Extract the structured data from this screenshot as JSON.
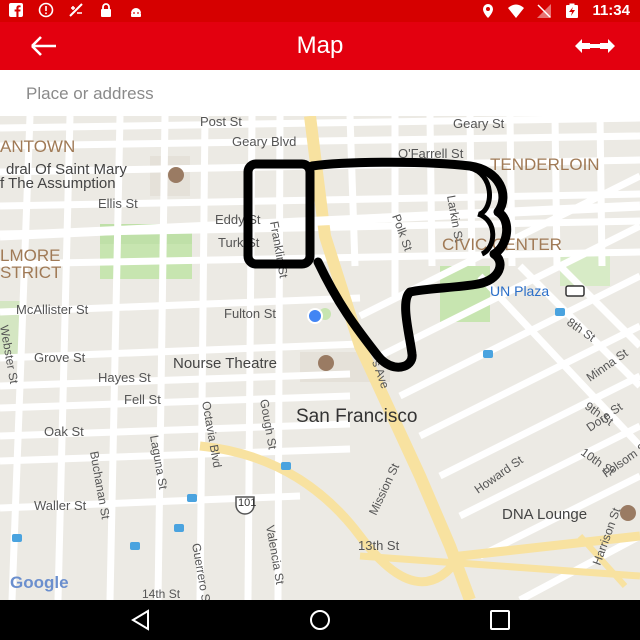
{
  "status_bar": {
    "time": "11:34",
    "icons": [
      "facebook-icon",
      "alert-icon",
      "no-signal-icon",
      "lock-icon",
      "android-icon",
      "location-icon",
      "wifi-icon",
      "no-sim-icon",
      "battery-charging-icon"
    ]
  },
  "app_bar": {
    "title": "Map",
    "back_icon": "arrow-left-icon",
    "action_icon": "swap-arrows-icon",
    "background": "#e3000f"
  },
  "search": {
    "placeholder": "Place or address"
  },
  "map": {
    "labels": {
      "post_st": "Post St",
      "geary_blvd": "Geary Blvd",
      "geary_st": "Geary St",
      "ofarrell_st": "O'Farrell St",
      "antown": "ANTOWN",
      "cathedral_1": "dral Of Saint Mary",
      "cathedral_2": "f The Assumption",
      "tenderloin": "TENDERLOIN",
      "ellis_st": "Ellis St",
      "eddy_st": "Eddy St",
      "turk_st": "Turk St",
      "franklin_st": "Franklin St",
      "polk_st": "Polk St",
      "larkin_st": "Larkin St",
      "civic_center": "CIVIC CENTER",
      "fillmore_1": "LMORE",
      "fillmore_2": "STRICT",
      "un_plaza": "UN Plaza",
      "mcallister_st": "McAllister St",
      "fulton_st": "Fulton St",
      "webster_st": "Webster St",
      "grove_st": "Grove St",
      "eighth_st": "8th St",
      "nourse_theatre": "Nourse Theatre",
      "hayes_st": "Hayes St",
      "fell_st": "Fell St",
      "octavia_blvd": "Octavia Blvd",
      "gough_st": "Gough St",
      "san_francisco": "San Francisco",
      "minna_st": "Minna St",
      "ninth_st": "9th St",
      "oak_st": "Oak St",
      "laguna_st": "Laguna St",
      "buchanan_st": "Buchanan St",
      "dore_st": "Dore St",
      "tenth_st": "10th St",
      "folsom_st": "Folsom St",
      "howard_st": "Howard St",
      "mission_st": "Mission St",
      "ave": "s Ave",
      "waller_st": "Waller St",
      "route_101": "101",
      "dna_lounge": "DNA Lounge",
      "valencia_st": "Valencia St",
      "guerrero_st": "Guerrero St",
      "thirteenth_st": "13th St",
      "harrison_st": "Harrison St",
      "fourteenth_st": "14th St",
      "google": "Google"
    }
  },
  "overlay": {
    "icon": "thumbs-down-icon"
  },
  "nav_bar": {
    "buttons": [
      "back-triangle-icon",
      "home-circle-icon",
      "recents-square-icon"
    ]
  }
}
